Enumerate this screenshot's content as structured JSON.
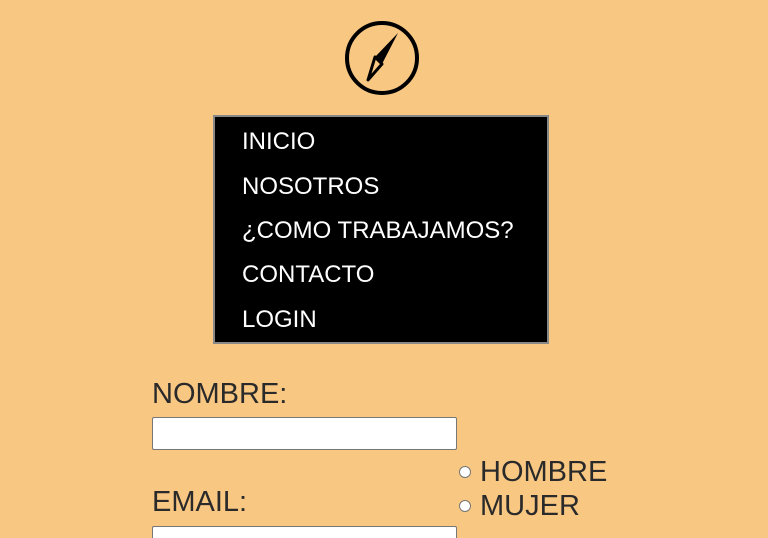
{
  "header": {
    "logo_icon": "compass-icon"
  },
  "nav": {
    "items": [
      {
        "label": "INICIO"
      },
      {
        "label": "NOSOTROS"
      },
      {
        "label": "¿COMO TRABAJAMOS?"
      },
      {
        "label": "CONTACTO"
      },
      {
        "label": "LOGIN"
      }
    ]
  },
  "form": {
    "nombre_label": "NOMBRE:",
    "nombre_value": "",
    "email_label": "EMAIL:",
    "email_value": "",
    "gender_options": [
      {
        "label": "HOMBRE",
        "checked": false
      },
      {
        "label": "MUJER",
        "checked": false
      }
    ]
  },
  "colors": {
    "background": "#f8c782",
    "menu_background": "#000000",
    "menu_text": "#ffffff",
    "label_text": "#2a2a2a"
  }
}
